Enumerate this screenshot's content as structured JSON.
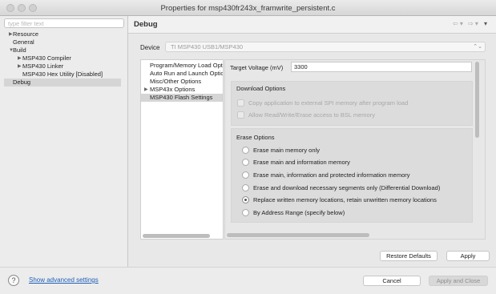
{
  "window": {
    "title": "Properties for msp430fr243x_framwrite_persistent.c"
  },
  "filter": {
    "placeholder": "type filter text"
  },
  "tree": {
    "items": [
      {
        "label": "Resource",
        "expander": "▶"
      },
      {
        "label": "General",
        "expander": ""
      },
      {
        "label": "Build",
        "expander": "▼"
      },
      {
        "label": "MSP430 Compiler",
        "expander": "▶"
      },
      {
        "label": "MSP430 Linker",
        "expander": "▶"
      },
      {
        "label": "MSP430 Hex Utility  [Disabled]",
        "expander": ""
      },
      {
        "label": "Debug",
        "expander": "",
        "selected": true
      }
    ]
  },
  "page": {
    "title": "Debug",
    "nav_back": "⇦ ▾",
    "nav_forward": "⇨ ▾",
    "menu": "▾"
  },
  "device": {
    "label": "Device",
    "value": "TI MSP430 USB1/MSP430",
    "chevron": "⌃⌄"
  },
  "subnav": {
    "items": [
      {
        "label": "Program/Memory Load Options",
        "expander": ""
      },
      {
        "label": "Auto Run and Launch Options",
        "expander": ""
      },
      {
        "label": "Misc/Other Options",
        "expander": ""
      },
      {
        "label": "MSP43x Options",
        "expander": "▶"
      },
      {
        "label": "MSP430 Flash Settings",
        "expander": "",
        "selected": true
      }
    ]
  },
  "settings": {
    "target_voltage_label": "Target Voltage (mV)",
    "target_voltage_value": "3300",
    "download_options": {
      "title": "Download Options",
      "items": [
        {
          "label": "Copy application to external SPI memory after program load",
          "checked": false,
          "enabled": false
        },
        {
          "label": "Allow Read/Write/Erase access to BSL memory",
          "checked": false,
          "enabled": false
        }
      ]
    },
    "erase_options": {
      "title": "Erase Options",
      "items": [
        {
          "label": "Erase main memory only",
          "selected": false
        },
        {
          "label": "Erase main and information memory",
          "selected": false
        },
        {
          "label": "Erase main, information and protected information memory",
          "selected": false
        },
        {
          "label": "Erase and download necessary segments only (Differential Download)",
          "selected": false
        },
        {
          "label": "Replace written memory locations, retain unwritten memory locations",
          "selected": true
        },
        {
          "label": "By Address Range (specify below)",
          "selected": false
        }
      ]
    }
  },
  "buttons": {
    "restore_defaults": "Restore Defaults",
    "apply": "Apply",
    "cancel": "Cancel",
    "apply_close": "Apply and Close"
  },
  "footer": {
    "help": "?",
    "advanced_link": "Show advanced settings"
  }
}
